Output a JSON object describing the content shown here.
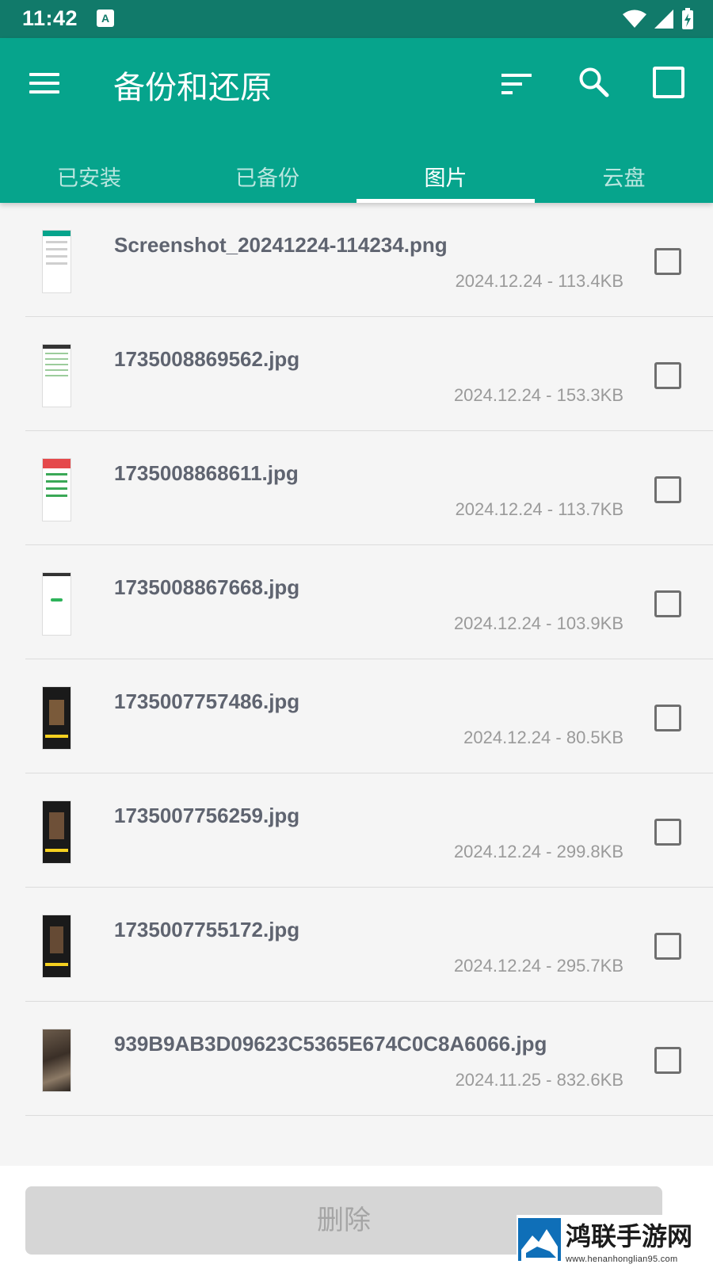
{
  "status_bar": {
    "time": "11:42"
  },
  "app_bar": {
    "title": "备份和还原"
  },
  "tabs": [
    {
      "label": "已安装",
      "active": false
    },
    {
      "label": "已备份",
      "active": false
    },
    {
      "label": "图片",
      "active": true
    },
    {
      "label": "云盘",
      "active": false
    }
  ],
  "files": [
    {
      "name": "Screenshot_20241224-114234.png",
      "meta": "2024.12.24 - 113.4KB",
      "thumb": "light"
    },
    {
      "name": "1735008869562.jpg",
      "meta": "2024.12.24 - 153.3KB",
      "thumb": "light"
    },
    {
      "name": "1735008868611.jpg",
      "meta": "2024.12.24 - 113.7KB",
      "thumb": "light"
    },
    {
      "name": "1735008867668.jpg",
      "meta": "2024.12.24 - 103.9KB",
      "thumb": "light"
    },
    {
      "name": "1735007757486.jpg",
      "meta": "2024.12.24 - 80.5KB",
      "thumb": "dark"
    },
    {
      "name": "1735007756259.jpg",
      "meta": "2024.12.24 - 299.8KB",
      "thumb": "dark"
    },
    {
      "name": "1735007755172.jpg",
      "meta": "2024.12.24 - 295.7KB",
      "thumb": "dark"
    },
    {
      "name": "939B9AB3D09623C5365E674C0C8A6066.jpg",
      "meta": "2024.11.25 - 832.6KB",
      "thumb": "photo"
    }
  ],
  "delete_button": {
    "label": "删除"
  },
  "watermark": {
    "title": "鸿联手游网",
    "url": "www.henanhonglian95.com"
  },
  "colors": {
    "primary": "#06a48c",
    "status_bar": "#117a6a",
    "filename": "#5f6470"
  }
}
